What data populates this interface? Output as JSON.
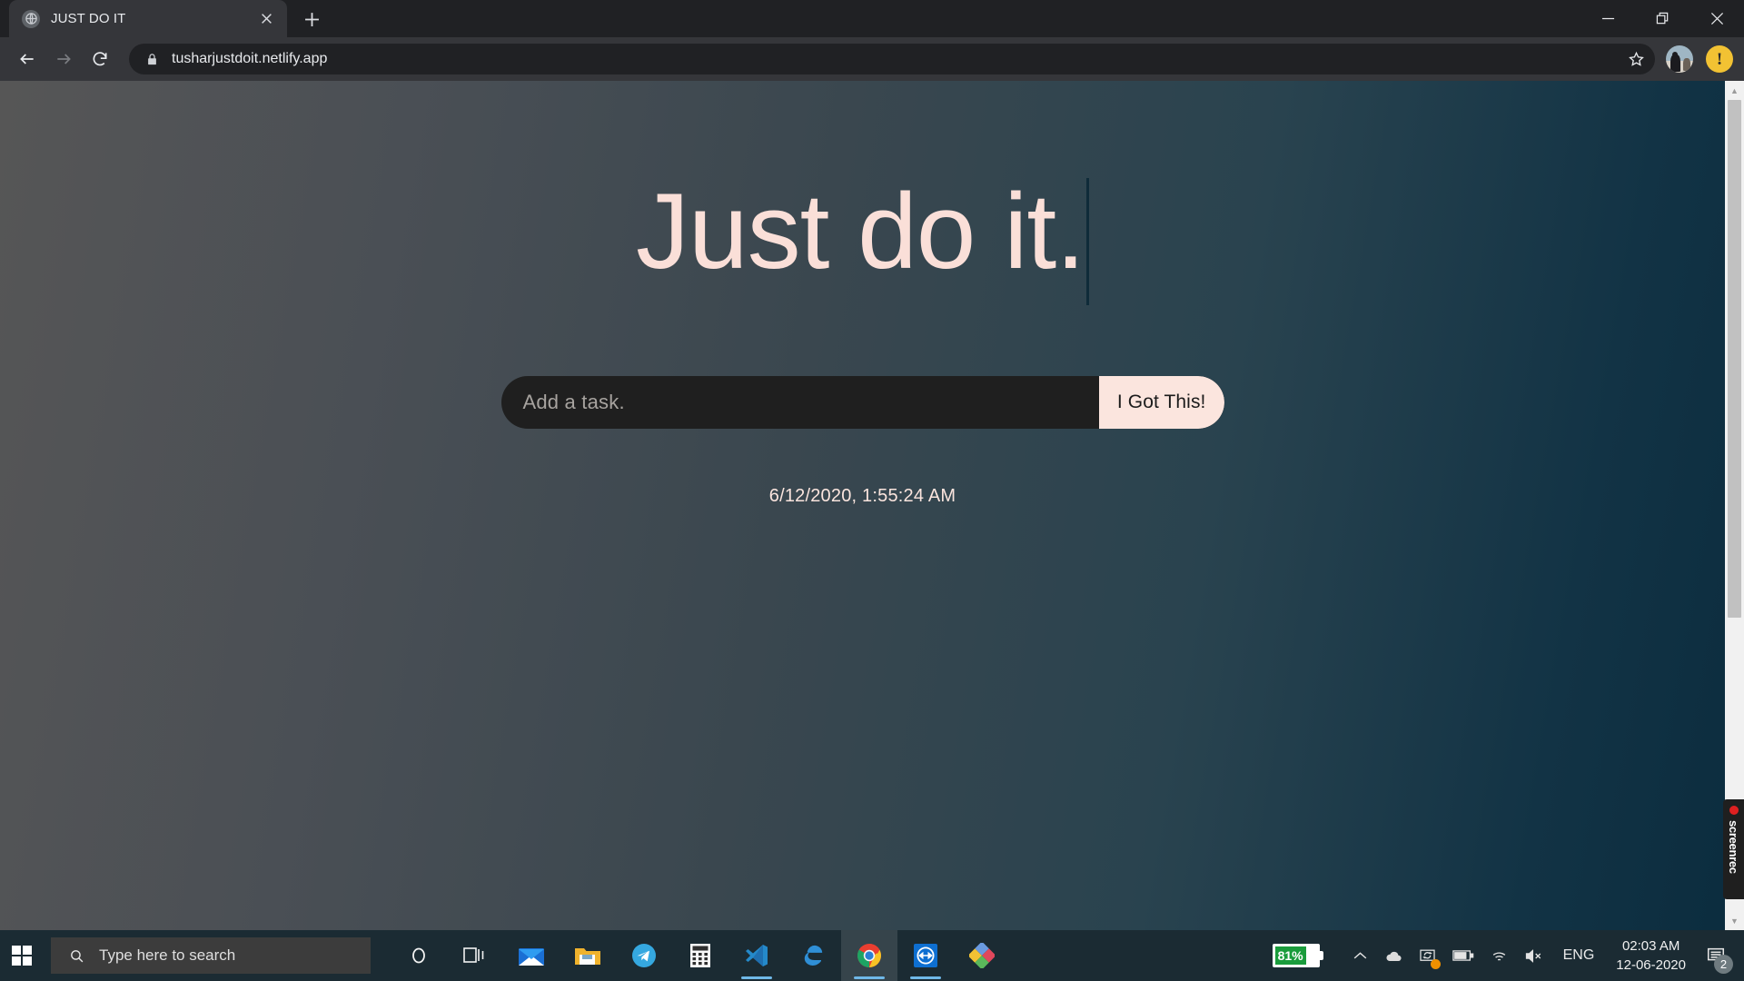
{
  "browser": {
    "tab": {
      "title": "JUST DO IT",
      "favicon": "globe-icon",
      "close": "×"
    },
    "new_tab_label": "+",
    "window_controls": {
      "minimize": "minimize-icon",
      "restore": "restore-icon",
      "close": "close-icon"
    },
    "nav": {
      "back": "back-arrow-icon",
      "forward": "forward-arrow-icon",
      "reload": "reload-icon"
    },
    "omnibox": {
      "lock": "lock-icon",
      "url": "tusharjustdoit.netlify.app",
      "star": "bookmark-star-icon"
    },
    "profile": "profile-avatar",
    "update_button": "!"
  },
  "page": {
    "headline": "Just do it.",
    "task_input_placeholder": "Add a task.",
    "task_input_value": "",
    "submit_label": "I Got This!",
    "timestamp": "6/12/2020, 1:55:24 AM",
    "colors": {
      "headline": "#fadfd8",
      "input_bg": "#1f1f1f",
      "button_bg": "#fbe5de",
      "bg_left": "#565656",
      "bg_right": "#0b2c3e"
    }
  },
  "screenrec": {
    "label": "screenrec",
    "recording_dot": "record-dot"
  },
  "taskbar": {
    "start": "windows-start-icon",
    "search_placeholder": "Type here to search",
    "search_icon": "search-icon",
    "pinned": [
      {
        "name": "cortana-icon",
        "label": "Cortana"
      },
      {
        "name": "task-view-icon",
        "label": "Task View"
      },
      {
        "name": "mail-icon",
        "label": "Mail"
      },
      {
        "name": "file-explorer-icon",
        "label": "File Explorer"
      },
      {
        "name": "telegram-icon",
        "label": "Telegram"
      },
      {
        "name": "calculator-icon",
        "label": "Calculator"
      },
      {
        "name": "vscode-icon",
        "label": "Visual Studio Code"
      },
      {
        "name": "edge-icon",
        "label": "Microsoft Edge"
      },
      {
        "name": "chrome-icon",
        "label": "Google Chrome"
      },
      {
        "name": "teamviewer-icon",
        "label": "TeamViewer"
      },
      {
        "name": "paint3d-icon",
        "label": "Paint 3D"
      }
    ],
    "tray": {
      "battery_percent": "81%",
      "chevron": "show-hidden-icons",
      "onedrive": "onedrive-icon",
      "sync": "sync-icon",
      "battery": "battery-icon",
      "wifi": "wifi-icon",
      "volume": "volume-muted-icon",
      "language": "ENG",
      "time": "02:03 AM",
      "date": "12-06-2020",
      "notification_count": "2"
    }
  }
}
